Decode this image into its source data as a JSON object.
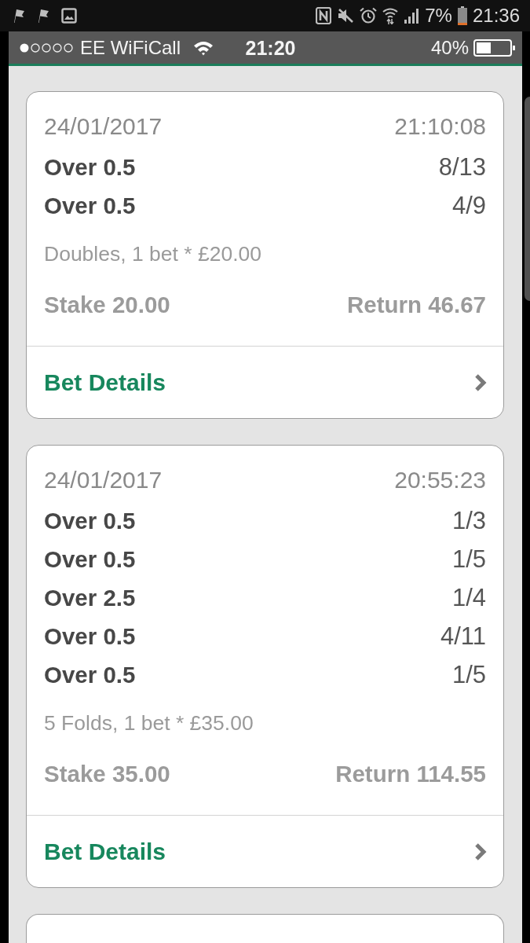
{
  "phone_status_bar": {
    "battery": "7%",
    "time": "21:36"
  },
  "ios_status_bar": {
    "carrier": "EE WiFiCall",
    "time": "21:20",
    "battery": "40%"
  },
  "bets": [
    {
      "date": "24/01/2017",
      "time": "21:10:08",
      "selections": [
        {
          "market": "Over 0.5",
          "odds": "8/13"
        },
        {
          "market": "Over 0.5",
          "odds": "4/9"
        }
      ],
      "description": "Doubles, 1 bet * £20.00",
      "stake": "Stake 20.00",
      "return": "Return 46.67",
      "link": "Bet Details"
    },
    {
      "date": "24/01/2017",
      "time": "20:55:23",
      "selections": [
        {
          "market": "Over 0.5",
          "odds": "1/3"
        },
        {
          "market": "Over 0.5",
          "odds": "1/5"
        },
        {
          "market": "Over 2.5",
          "odds": "1/4"
        },
        {
          "market": "Over 0.5",
          "odds": "4/11"
        },
        {
          "market": "Over 0.5",
          "odds": "1/5"
        }
      ],
      "description": "5 Folds, 1 bet * £35.00",
      "stake": "Stake 35.00",
      "return": "Return 114.55",
      "link": "Bet Details"
    }
  ]
}
